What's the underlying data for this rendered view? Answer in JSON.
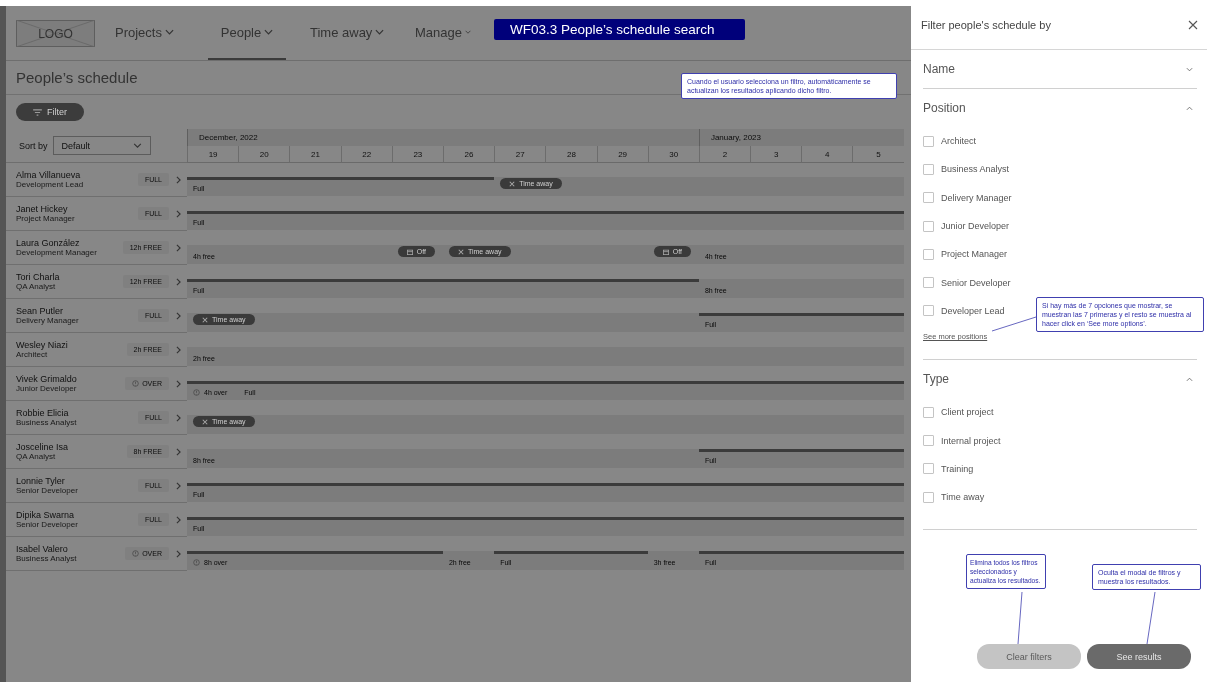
{
  "nav": {
    "logo": "LOGO",
    "items": [
      {
        "label": "Projects",
        "selected": false
      },
      {
        "label": "People",
        "selected": true
      },
      {
        "label": "Time away",
        "selected": false
      },
      {
        "label": "Manage",
        "selected": false
      }
    ],
    "banner": "WF03.3 People’s schedule search"
  },
  "page": {
    "title": "People’s schedule",
    "filter_button": "Filter",
    "sort": {
      "label": "Sort by",
      "value": "Default"
    }
  },
  "timeline": {
    "months": [
      "December, 2022",
      "January, 2023"
    ],
    "days": [
      "19",
      "20",
      "21",
      "22",
      "23",
      "26",
      "27",
      "28",
      "29",
      "30",
      "2",
      "3",
      "4",
      "5"
    ]
  },
  "people": [
    {
      "name": "Alma Villanueva",
      "role": "Development Lead",
      "badge": {
        "label": "FULL",
        "kind": "plain"
      },
      "segments": [
        {
          "label": "Full",
          "kind": "bar",
          "full": true
        },
        {
          "label": "Time away",
          "kind": "away",
          "full": false
        }
      ]
    },
    {
      "name": "Janet Hickey",
      "role": "Project Manager",
      "badge": {
        "label": "FULL",
        "kind": "plain"
      },
      "segments": [
        {
          "label": "Full",
          "kind": "bar",
          "full": true
        }
      ]
    },
    {
      "name": "Laura González",
      "role": "Development Manager",
      "badge": {
        "label": "12h FREE",
        "kind": "plain"
      },
      "segments": [
        {
          "label": "4h free",
          "kind": "bar",
          "full": false
        },
        {
          "label": "Off",
          "kind": "off",
          "full": false
        },
        {
          "label": "Time away",
          "kind": "away",
          "full": false
        },
        {
          "label": "Off",
          "kind": "off",
          "full": false
        },
        {
          "label": "4h free",
          "kind": "bar",
          "full": false
        }
      ]
    },
    {
      "name": "Tori Charla",
      "role": "QA Analyst",
      "badge": {
        "label": "12h FREE",
        "kind": "plain"
      },
      "segments": [
        {
          "label": "Full",
          "kind": "bar",
          "full": true
        },
        {
          "label": "8h free",
          "kind": "bar",
          "full": false
        }
      ]
    },
    {
      "name": "Sean Putler",
      "role": "Delivery Manager",
      "badge": {
        "label": "FULL",
        "kind": "plain"
      },
      "segments": [
        {
          "label": "Time away",
          "kind": "away",
          "full": false
        },
        {
          "label": "Full",
          "kind": "bar",
          "full": true
        }
      ]
    },
    {
      "name": "Wesley Niazi",
      "role": "Architect",
      "badge": {
        "label": "2h FREE",
        "kind": "plain"
      },
      "segments": [
        {
          "label": "2h free",
          "kind": "bar",
          "full": false
        }
      ]
    },
    {
      "name": "Vivek Grimaldo",
      "role": "Junior Developer",
      "badge": {
        "label": "OVER",
        "kind": "over"
      },
      "segments": [
        {
          "label": "4h over",
          "kind": "over",
          "full": true
        },
        {
          "label": "Full",
          "kind": "bar",
          "full": true
        }
      ]
    },
    {
      "name": "Robbie Elicia",
      "role": "Business Analyst",
      "badge": {
        "label": "FULL",
        "kind": "plain"
      },
      "segments": [
        {
          "label": "Time away",
          "kind": "away",
          "full": false
        }
      ]
    },
    {
      "name": "Josceline Isa",
      "role": "QA Analyst",
      "badge": {
        "label": "8h FREE",
        "kind": "plain"
      },
      "segments": [
        {
          "label": "8h free",
          "kind": "bar",
          "full": false
        },
        {
          "label": "Full",
          "kind": "bar",
          "full": true
        }
      ]
    },
    {
      "name": "Lonnie Tyler",
      "role": "Senior Developer",
      "badge": {
        "label": "FULL",
        "kind": "plain"
      },
      "segments": [
        {
          "label": "Full",
          "kind": "bar",
          "full": true
        }
      ]
    },
    {
      "name": "Dipika Swarna",
      "role": "Senior Developer",
      "badge": {
        "label": "FULL",
        "kind": "plain"
      },
      "segments": [
        {
          "label": "Full",
          "kind": "bar",
          "full": true
        }
      ]
    },
    {
      "name": "Isabel Valero",
      "role": "Business Analyst",
      "badge": {
        "label": "OVER",
        "kind": "over"
      },
      "segments": [
        {
          "label": "8h over",
          "kind": "over",
          "full": true
        },
        {
          "label": "2h free",
          "kind": "bar",
          "full": false
        },
        {
          "label": "Full",
          "kind": "bar",
          "full": true
        },
        {
          "label": "3h free",
          "kind": "bar",
          "full": false
        },
        {
          "label": "Full",
          "kind": "bar",
          "full": true
        }
      ]
    }
  ],
  "filter_panel": {
    "title": "Filter people's schedule by",
    "sections": [
      {
        "title": "Name",
        "expanded": false
      },
      {
        "title": "Position",
        "expanded": true,
        "options": [
          {
            "label": "Architect",
            "checked": false
          },
          {
            "label": "Business Analyst",
            "checked": false
          },
          {
            "label": "Delivery Manager",
            "checked": false
          },
          {
            "label": "Junior Developer",
            "checked": false
          },
          {
            "label": "Project Manager",
            "checked": false
          },
          {
            "label": "Senior Developer",
            "checked": false
          },
          {
            "label": "Developer Lead",
            "checked": false
          }
        ],
        "more_link": "See more positions"
      },
      {
        "title": "Type",
        "expanded": true,
        "options": [
          {
            "label": "Client project",
            "checked": false
          },
          {
            "label": "Internal project",
            "checked": false
          },
          {
            "label": "Training",
            "checked": false
          },
          {
            "label": "Time away",
            "checked": false
          }
        ]
      }
    ],
    "buttons": [
      {
        "label": "Clear filters",
        "disabled": true
      },
      {
        "label": "See results",
        "disabled": false
      }
    ]
  },
  "notes": [
    "Cuando el usuario selecciona un filtro, automáticamente se actualizan los resultados aplicando dicho filtro.",
    "Si hay más de 7 opciones que mostrar, se muestran las 7 primeras y el resto se muestra al hacer click en ‘See more options’.",
    "Elimina todos los filtros seleccionados y actualiza los resultados.",
    "Oculta el modal de filtros y muestra los resultados."
  ]
}
